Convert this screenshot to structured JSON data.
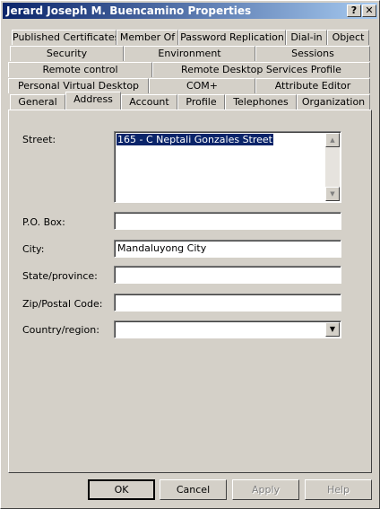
{
  "window": {
    "title": "Jerard Joseph M. Buencamino Properties",
    "help_glyph": "?",
    "close_glyph": "✕"
  },
  "tabs": {
    "row1": [
      "Published Certificates",
      "Member Of",
      "Password Replication",
      "Dial-in",
      "Object"
    ],
    "row2": [
      "Security",
      "Environment",
      "Sessions"
    ],
    "row3": [
      "Remote control",
      "Remote Desktop Services Profile"
    ],
    "row4": [
      "Personal Virtual Desktop",
      "COM+",
      "Attribute Editor"
    ],
    "row5": [
      "General",
      "Address",
      "Account",
      "Profile",
      "Telephones",
      "Organization"
    ],
    "active": "Address"
  },
  "form": {
    "street_label": "Street:",
    "street_value": "165 - C Neptali Gonzales Street",
    "pobox_label": "P.O. Box:",
    "pobox_value": "",
    "city_label": "City:",
    "city_value": "Mandaluyong City",
    "state_label": "State/province:",
    "state_value": "",
    "zip_label": "Zip/Postal Code:",
    "zip_value": "",
    "country_label": "Country/region:",
    "country_value": ""
  },
  "buttons": {
    "ok": "OK",
    "cancel": "Cancel",
    "apply": "Apply",
    "help": "Help"
  },
  "colors": {
    "titlebar_start": "#0a246a",
    "titlebar_end": "#a6caf0",
    "face": "#d4d0c8",
    "selection": "#0a246a"
  }
}
